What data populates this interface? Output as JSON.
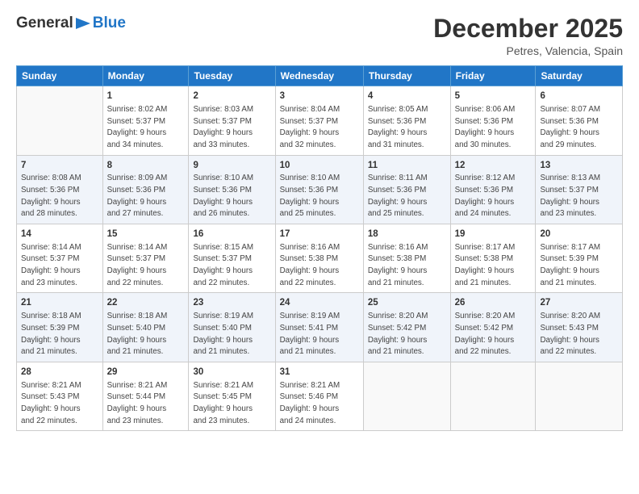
{
  "logo": {
    "general": "General",
    "blue": "Blue"
  },
  "title": "December 2025",
  "location": "Petres, Valencia, Spain",
  "days_of_week": [
    "Sunday",
    "Monday",
    "Tuesday",
    "Wednesday",
    "Thursday",
    "Friday",
    "Saturday"
  ],
  "weeks": [
    [
      {
        "day": "",
        "info": ""
      },
      {
        "day": "1",
        "info": "Sunrise: 8:02 AM\nSunset: 5:37 PM\nDaylight: 9 hours\nand 34 minutes."
      },
      {
        "day": "2",
        "info": "Sunrise: 8:03 AM\nSunset: 5:37 PM\nDaylight: 9 hours\nand 33 minutes."
      },
      {
        "day": "3",
        "info": "Sunrise: 8:04 AM\nSunset: 5:37 PM\nDaylight: 9 hours\nand 32 minutes."
      },
      {
        "day": "4",
        "info": "Sunrise: 8:05 AM\nSunset: 5:36 PM\nDaylight: 9 hours\nand 31 minutes."
      },
      {
        "day": "5",
        "info": "Sunrise: 8:06 AM\nSunset: 5:36 PM\nDaylight: 9 hours\nand 30 minutes."
      },
      {
        "day": "6",
        "info": "Sunrise: 8:07 AM\nSunset: 5:36 PM\nDaylight: 9 hours\nand 29 minutes."
      }
    ],
    [
      {
        "day": "7",
        "info": "Sunrise: 8:08 AM\nSunset: 5:36 PM\nDaylight: 9 hours\nand 28 minutes."
      },
      {
        "day": "8",
        "info": "Sunrise: 8:09 AM\nSunset: 5:36 PM\nDaylight: 9 hours\nand 27 minutes."
      },
      {
        "day": "9",
        "info": "Sunrise: 8:10 AM\nSunset: 5:36 PM\nDaylight: 9 hours\nand 26 minutes."
      },
      {
        "day": "10",
        "info": "Sunrise: 8:10 AM\nSunset: 5:36 PM\nDaylight: 9 hours\nand 25 minutes."
      },
      {
        "day": "11",
        "info": "Sunrise: 8:11 AM\nSunset: 5:36 PM\nDaylight: 9 hours\nand 25 minutes."
      },
      {
        "day": "12",
        "info": "Sunrise: 8:12 AM\nSunset: 5:36 PM\nDaylight: 9 hours\nand 24 minutes."
      },
      {
        "day": "13",
        "info": "Sunrise: 8:13 AM\nSunset: 5:37 PM\nDaylight: 9 hours\nand 23 minutes."
      }
    ],
    [
      {
        "day": "14",
        "info": "Sunrise: 8:14 AM\nSunset: 5:37 PM\nDaylight: 9 hours\nand 23 minutes."
      },
      {
        "day": "15",
        "info": "Sunrise: 8:14 AM\nSunset: 5:37 PM\nDaylight: 9 hours\nand 22 minutes."
      },
      {
        "day": "16",
        "info": "Sunrise: 8:15 AM\nSunset: 5:37 PM\nDaylight: 9 hours\nand 22 minutes."
      },
      {
        "day": "17",
        "info": "Sunrise: 8:16 AM\nSunset: 5:38 PM\nDaylight: 9 hours\nand 22 minutes."
      },
      {
        "day": "18",
        "info": "Sunrise: 8:16 AM\nSunset: 5:38 PM\nDaylight: 9 hours\nand 21 minutes."
      },
      {
        "day": "19",
        "info": "Sunrise: 8:17 AM\nSunset: 5:38 PM\nDaylight: 9 hours\nand 21 minutes."
      },
      {
        "day": "20",
        "info": "Sunrise: 8:17 AM\nSunset: 5:39 PM\nDaylight: 9 hours\nand 21 minutes."
      }
    ],
    [
      {
        "day": "21",
        "info": "Sunrise: 8:18 AM\nSunset: 5:39 PM\nDaylight: 9 hours\nand 21 minutes."
      },
      {
        "day": "22",
        "info": "Sunrise: 8:18 AM\nSunset: 5:40 PM\nDaylight: 9 hours\nand 21 minutes."
      },
      {
        "day": "23",
        "info": "Sunrise: 8:19 AM\nSunset: 5:40 PM\nDaylight: 9 hours\nand 21 minutes."
      },
      {
        "day": "24",
        "info": "Sunrise: 8:19 AM\nSunset: 5:41 PM\nDaylight: 9 hours\nand 21 minutes."
      },
      {
        "day": "25",
        "info": "Sunrise: 8:20 AM\nSunset: 5:42 PM\nDaylight: 9 hours\nand 21 minutes."
      },
      {
        "day": "26",
        "info": "Sunrise: 8:20 AM\nSunset: 5:42 PM\nDaylight: 9 hours\nand 22 minutes."
      },
      {
        "day": "27",
        "info": "Sunrise: 8:20 AM\nSunset: 5:43 PM\nDaylight: 9 hours\nand 22 minutes."
      }
    ],
    [
      {
        "day": "28",
        "info": "Sunrise: 8:21 AM\nSunset: 5:43 PM\nDaylight: 9 hours\nand 22 minutes."
      },
      {
        "day": "29",
        "info": "Sunrise: 8:21 AM\nSunset: 5:44 PM\nDaylight: 9 hours\nand 23 minutes."
      },
      {
        "day": "30",
        "info": "Sunrise: 8:21 AM\nSunset: 5:45 PM\nDaylight: 9 hours\nand 23 minutes."
      },
      {
        "day": "31",
        "info": "Sunrise: 8:21 AM\nSunset: 5:46 PM\nDaylight: 9 hours\nand 24 minutes."
      },
      {
        "day": "",
        "info": ""
      },
      {
        "day": "",
        "info": ""
      },
      {
        "day": "",
        "info": ""
      }
    ]
  ]
}
